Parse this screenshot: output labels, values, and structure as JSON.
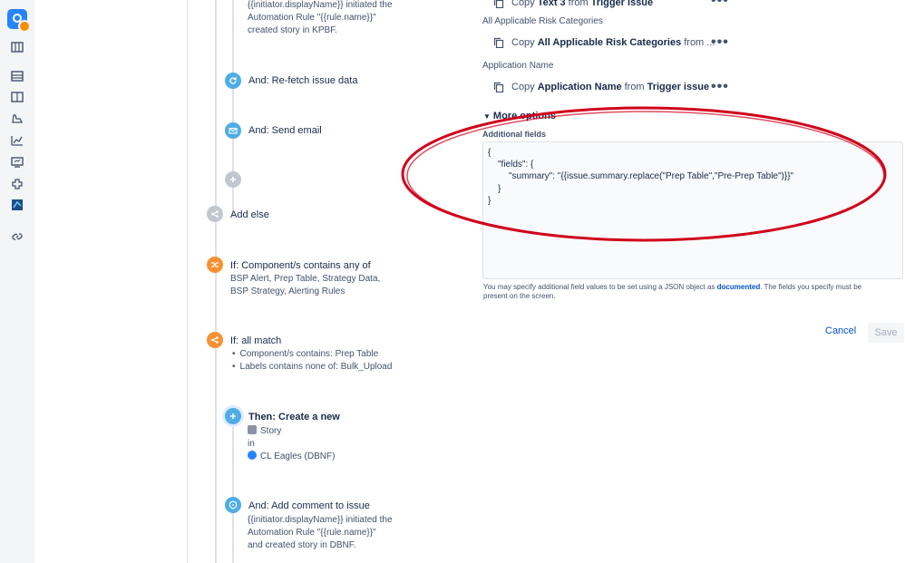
{
  "rail": {
    "icons": [
      "app-logo-icon",
      "board-icon",
      "backlog-icon",
      "columns-icon",
      "releases-icon",
      "reports-icon",
      "pages-icon",
      "addons-icon",
      "app-icon",
      "link-icon"
    ]
  },
  "flow": {
    "top_comment": {
      "line1": "{{initiator.displayName}} initiated the",
      "line2": "Automation Rule \"{{rule.name}}\"",
      "line3": "created story in KPBF."
    },
    "refetch": "And: Re-fetch issue data",
    "send_email": "And: Send email",
    "add_else": "Add else",
    "if_component": {
      "title": "If: Component/s contains any of",
      "line1": "BSP Alert, Prep Table, Strategy Data,",
      "line2": "BSP Strategy, Alerting Rules"
    },
    "if_all": {
      "title": "If: all match",
      "conditions": [
        "Component/s contains: Prep Table",
        "Labels contains none of: Bulk_Upload"
      ]
    },
    "then_create": {
      "title": "Then: Create a new",
      "issue_type": "Story",
      "in": "in",
      "project": "CL Eagles (DBNF)"
    },
    "add_comment": {
      "title": "And: Add comment to issue",
      "line1": "{{initiator.displayName}} initiated the",
      "line2": "Automation Rule \"{{rule.name}}\"",
      "line3": "and created story in DBNF."
    }
  },
  "panel": {
    "row0": {
      "prefix": "Copy",
      "field": "Text 3",
      "mid": "from",
      "source": "Trigger issue"
    },
    "label1": "All Applicable Risk Categories",
    "row1": {
      "prefix": "Copy",
      "field": "All Applicable Risk Categories",
      "mid": "from ..."
    },
    "label2": "Application Name",
    "row2": {
      "prefix": "Copy",
      "field": "Application Name",
      "mid": "from",
      "source": "Trigger issue"
    },
    "more_options": "More options",
    "additional_fields": "Additional fields",
    "json_lines": [
      "{",
      "\"fields\": {",
      "\"summary\": \"{{issue.summary.replace(\"Prep Table\",\"Pre-Prep Table\")}}\"",
      "}",
      "}"
    ],
    "help_text": "You may specify additional field values to be set using a JSON object as",
    "help_link": "documented",
    "help_text2": ". The fields you specify must be present on the screen.",
    "cancel": "Cancel",
    "save": "Save"
  },
  "colors": {
    "node_blue": "#4fade6",
    "node_orange": "#f79232",
    "annotation": "#d0021b",
    "link": "#0052cc"
  }
}
